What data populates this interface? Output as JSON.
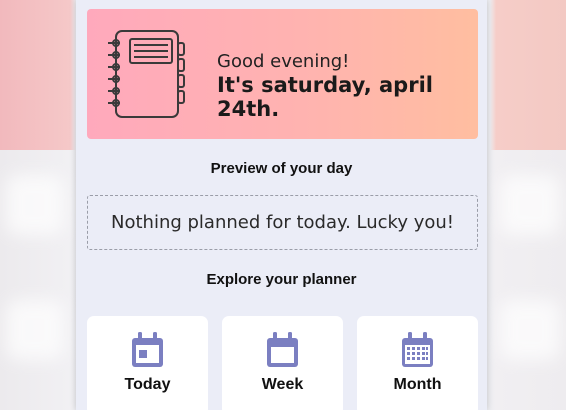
{
  "hero": {
    "greeting": "Good evening!",
    "date": "It's saturday, april 24th."
  },
  "preview": {
    "title": "Preview of your day",
    "empty_message": "Nothing planned for today. Lucky you!"
  },
  "explore": {
    "title": "Explore your planner",
    "cards": [
      {
        "label": "Today",
        "icon": "calendar-day-icon"
      },
      {
        "label": "Week",
        "icon": "calendar-week-icon"
      },
      {
        "label": "Month",
        "icon": "calendar-month-icon"
      }
    ]
  },
  "colors": {
    "accent_icon": "#7b7fc1",
    "hero_gradient_start": "#ffa9bc",
    "hero_gradient_end": "#ffbea0",
    "panel_bg": "#ebedf7"
  }
}
